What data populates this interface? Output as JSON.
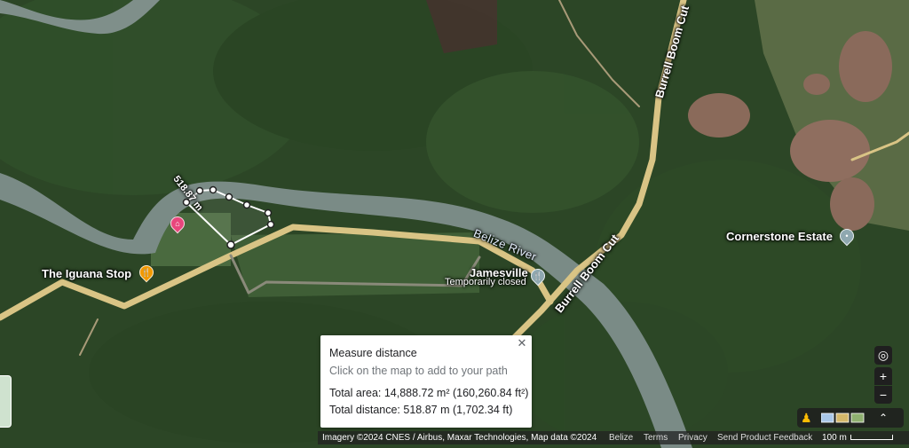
{
  "places": {
    "iguana_stop": "The Iguana Stop",
    "jamesville": "Jamesville",
    "jamesville_status": "Temporarily closed",
    "cornerstone": "Cornerstone Estate",
    "belize_river": "Belize River",
    "burrell_boom_cut_top": "Burrell Boom Cut",
    "burrell_boom_cut_bottom": "Burrell Boom Cut",
    "segment_label": "518.87 m"
  },
  "measure": {
    "title": "Measure distance",
    "hint": "Click on the map to add to your path",
    "total_area": "Total area: 14,888.72 m² (160,260.84 ft²)",
    "total_distance": "Total distance: 518.87 m (1,702.34 ft)",
    "close_icon": "close-icon"
  },
  "footer": {
    "imagery": "Imagery ©2024 CNES / Airbus, Maxar Technologies, Map data ©2024",
    "country": "Belize",
    "terms": "Terms",
    "privacy": "Privacy",
    "feedback": "Send Product Feedback",
    "scale": "100 m"
  },
  "controls": {
    "zoom_in": "+",
    "zoom_out": "−",
    "expand": "⌃",
    "location_icon": "my-location-icon",
    "pegman_icon": "pegman-icon"
  },
  "colors": {
    "road": "#d9c485",
    "river": "#7a8b86",
    "forest": "#2f4a2a",
    "poi_orange": "#f29900",
    "poi_pink": "#e8467c",
    "poi_blue": "#4285f4"
  }
}
